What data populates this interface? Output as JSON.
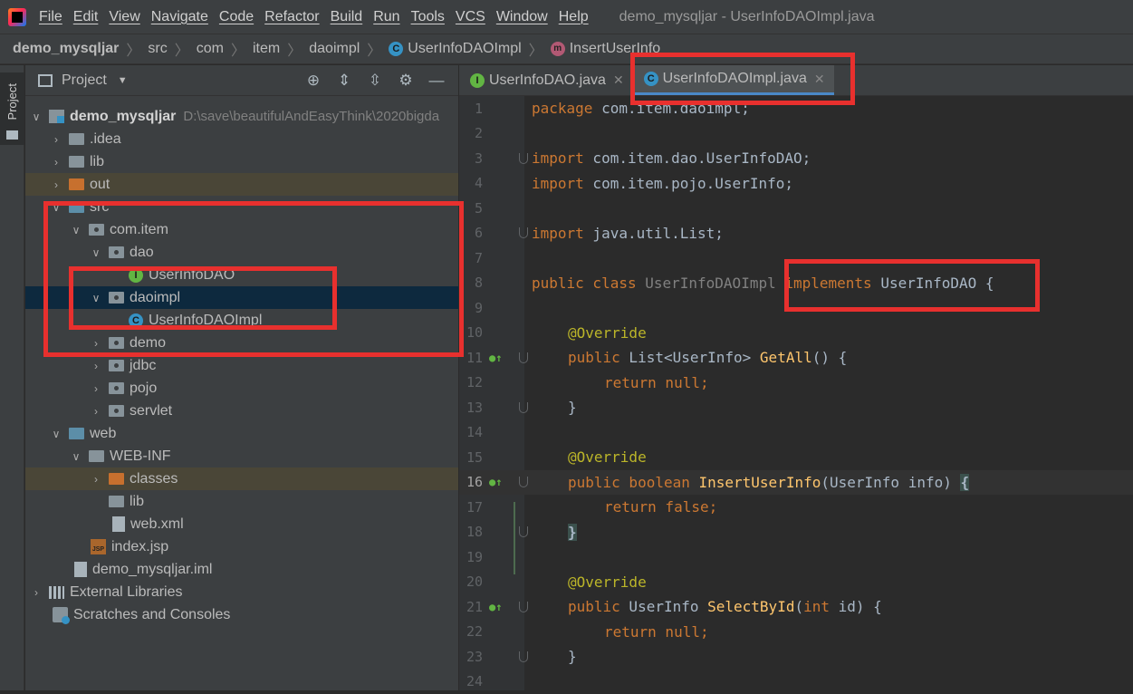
{
  "menubar": {
    "items": [
      "File",
      "Edit",
      "View",
      "Navigate",
      "Code",
      "Refactor",
      "Build",
      "Run",
      "Tools",
      "VCS",
      "Window",
      "Help"
    ],
    "window_title": "demo_mysqljar - UserInfoDAOImpl.java"
  },
  "breadcrumb": [
    "demo_mysqljar",
    "src",
    "com",
    "item",
    "daoimpl",
    "UserInfoDAOImpl",
    "InsertUserInfo"
  ],
  "sidebar": {
    "label": "Project"
  },
  "project_panel": {
    "title": "Project",
    "tree": {
      "root_name": "demo_mysqljar",
      "root_path": "D:\\save\\beautifulAndEasyThink\\2020bigda",
      "idea": ".idea",
      "lib": "lib",
      "out": "out",
      "src": "src",
      "com_item": "com.item",
      "dao": "dao",
      "userinfodao": "UserInfoDAO",
      "daoimpl": "daoimpl",
      "userinfodaoimpl": "UserInfoDAOImpl",
      "demo": "demo",
      "jdbc": "jdbc",
      "pojo": "pojo",
      "servlet": "servlet",
      "web": "web",
      "webinf": "WEB-INF",
      "classes": "classes",
      "web_lib": "lib",
      "webxml": "web.xml",
      "indexjsp": "index.jsp",
      "iml": "demo_mysqljar.iml",
      "ext_libs": "External Libraries",
      "scratches": "Scratches and Consoles"
    }
  },
  "editor": {
    "tabs": [
      {
        "label": "UserInfoDAO.java",
        "icon": "I",
        "active": false
      },
      {
        "label": "UserInfoDAOImpl.java",
        "icon": "C",
        "active": true
      }
    ],
    "line_numbers": [
      "1",
      "2",
      "3",
      "4",
      "5",
      "6",
      "7",
      "8",
      "9",
      "10",
      "11",
      "12",
      "13",
      "14",
      "15",
      "16",
      "17",
      "18",
      "19",
      "20",
      "21",
      "22",
      "23",
      "24"
    ],
    "current_line": 16,
    "code": {
      "l1_kw": "package",
      "l1_rest": " com.item.daoimpl;",
      "l3_kw": "import",
      "l3_rest": " com.item.dao.UserInfoDAO;",
      "l4_kw": "import",
      "l4_rest": " com.item.pojo.UserInfo;",
      "l6_kw": "import",
      "l6_rest": " java.util.List;",
      "l8_kw": "public class",
      "l8_name": " UserInfoDAOImpl ",
      "l8_impl": "implements",
      "l8_rest": " UserInfoDAO {",
      "l10_ann": "@Override",
      "l11_kw": "public",
      "l11_type": " List<UserInfo> ",
      "l11_fn": "GetAll",
      "l11_rest": "() {",
      "l12_kw": "return null",
      "l12_rest": ";",
      "l13": "}",
      "l15_ann": "@Override",
      "l16_kw": "public boolean",
      "l16_fn": " InsertUserInfo",
      "l16_rest": "(UserInfo info) ",
      "l16_brace": "{",
      "l17_kw": "return false",
      "l17_rest": ";",
      "l18_brace": "}",
      "l20_ann": "@Override",
      "l21_kw": "public",
      "l21_type": " UserInfo ",
      "l21_fn": "SelectById",
      "l21_p": "(",
      "l21_int": "int",
      "l21_rest": " id) {",
      "l22_kw": "return null",
      "l22_rest": ";",
      "l23": "}"
    }
  },
  "colors": {
    "highlight": "#e8302e",
    "accent": "#4a88c7",
    "keyword": "#cc7832",
    "annotation": "#bbb529",
    "function": "#ffc66d"
  }
}
